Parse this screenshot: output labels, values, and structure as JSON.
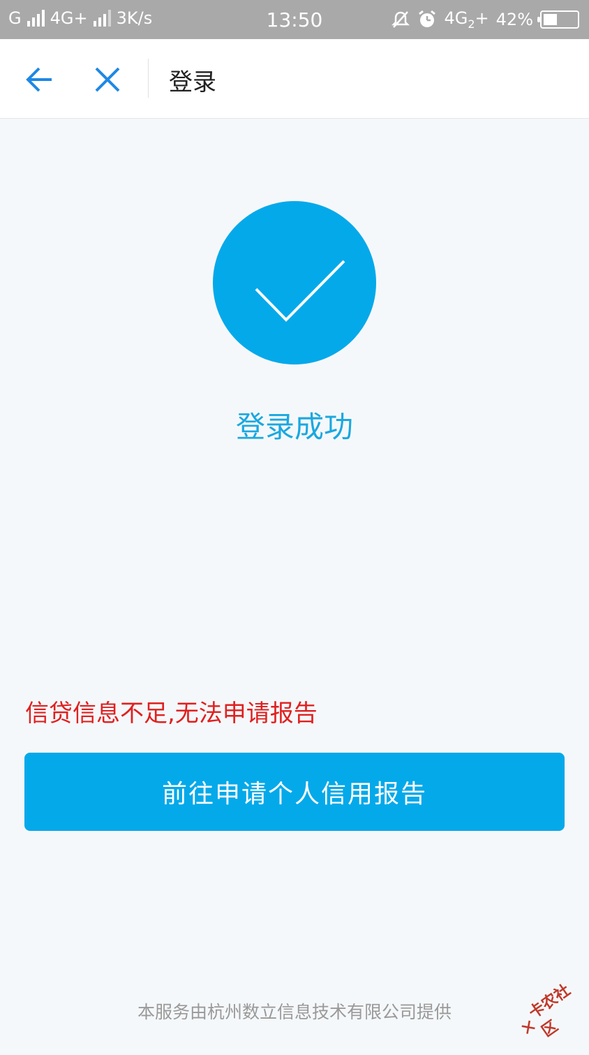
{
  "status_bar": {
    "carrier_left": "G",
    "network_type": "4G+",
    "speed": "3K/s",
    "time": "13:50",
    "network_right": "4G",
    "sim_slot": "2",
    "network_right_plus": "+",
    "battery": "42%",
    "battery_level": 0.42,
    "icons": [
      "signal-icon",
      "mute-bell-icon",
      "alarm-clock-icon",
      "battery-icon"
    ]
  },
  "nav": {
    "title": "登录",
    "back_icon": "arrow-left-icon",
    "close_icon": "close-icon"
  },
  "main": {
    "success_icon": "checkmark-icon",
    "success_text": "登录成功",
    "warning_text": "信贷信息不足,无法申请报告",
    "button_label": "前往申请个人信用报告"
  },
  "footer": {
    "provider_text": "本服务由杭州数立信息技术有限公司提供",
    "watermark_text": "卡农社区"
  },
  "colors": {
    "accent": "#04a9ea",
    "warning": "#e02020",
    "status_bar_bg": "#a9a9a9",
    "page_bg": "#f5f8fa"
  }
}
